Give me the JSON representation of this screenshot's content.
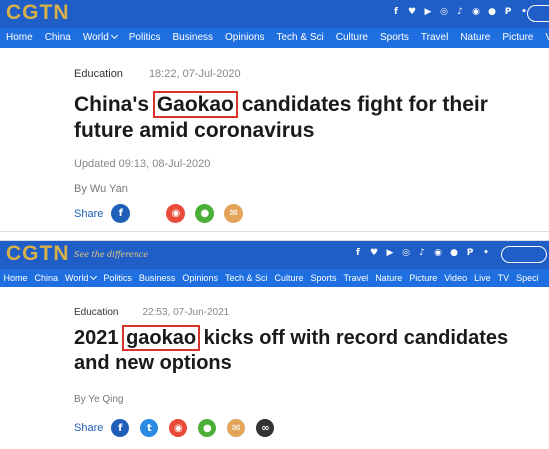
{
  "screenshot_a": {
    "logo": "CGTN",
    "nav": [
      "Home",
      "China",
      "World",
      "Politics",
      "Business",
      "Opinions",
      "Tech & Sci",
      "Culture",
      "Sports",
      "Travel",
      "Nature",
      "Picture",
      "Vide"
    ],
    "social_icons": [
      "facebook-icon",
      "twitter-icon",
      "youtube-icon",
      "instagram-icon",
      "tiktok-icon",
      "weibo-icon",
      "wechat-icon",
      "pinterest-icon",
      "share-icon"
    ],
    "category": "Education",
    "time": "18:22, 07-Jul-2020",
    "headline_before": "China's ",
    "headline_highlight": "Gaokao",
    "headline_after": " candidates fight for their future amid coronavirus",
    "updated": "Updated 09:13, 08-Jul-2020",
    "byline": "By Wu Yan",
    "share_label": "Share",
    "share_icons": [
      "facebook-icon",
      "weibo-icon",
      "wechat-icon",
      "email-icon"
    ]
  },
  "screenshot_b": {
    "logo": "CGTN",
    "slogan": "See the difference",
    "nav": [
      "Home",
      "China",
      "World",
      "Politics",
      "Business",
      "Opinions",
      "Tech & Sci",
      "Culture",
      "Sports",
      "Travel",
      "Nature",
      "Picture",
      "Video",
      "Live",
      "TV",
      "Speci"
    ],
    "social_icons": [
      "facebook-icon",
      "twitter-icon",
      "youtube-icon",
      "instagram-icon",
      "tiktok-icon",
      "weibo-icon",
      "wechat-icon",
      "pinterest-icon",
      "share-icon"
    ],
    "category": "Education",
    "time": "22:53, 07-Jun-2021",
    "headline_before": "2021 ",
    "headline_highlight": "gaokao",
    "headline_after": " kicks off with record candidates and new options",
    "byline": "By Ye Qing",
    "share_label": "Share",
    "share_icons": [
      "facebook-icon",
      "twitter-icon",
      "weibo-icon",
      "wechat-icon",
      "email-icon",
      "link-icon"
    ]
  },
  "colors": {
    "topbar": "#1e5ec6",
    "navbar": "#1f6fe0",
    "logo": "#d7b04a",
    "highlight_box": "#d9332b"
  }
}
